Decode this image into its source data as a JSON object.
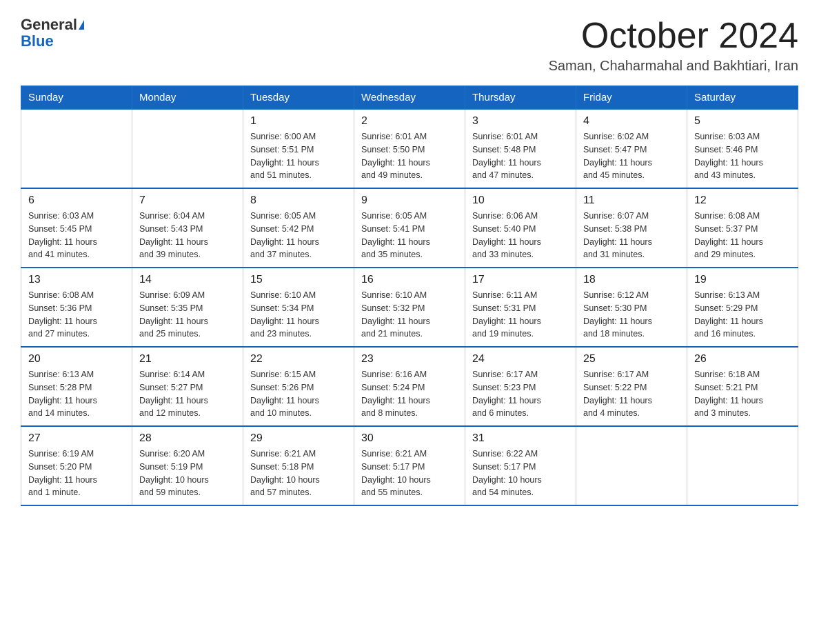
{
  "header": {
    "logo_general": "General",
    "logo_blue": "Blue",
    "title": "October 2024",
    "subtitle": "Saman, Chaharmahal and Bakhtiari, Iran"
  },
  "days_of_week": [
    "Sunday",
    "Monday",
    "Tuesday",
    "Wednesday",
    "Thursday",
    "Friday",
    "Saturday"
  ],
  "weeks": [
    [
      {
        "day": "",
        "info": ""
      },
      {
        "day": "",
        "info": ""
      },
      {
        "day": "1",
        "info": "Sunrise: 6:00 AM\nSunset: 5:51 PM\nDaylight: 11 hours\nand 51 minutes."
      },
      {
        "day": "2",
        "info": "Sunrise: 6:01 AM\nSunset: 5:50 PM\nDaylight: 11 hours\nand 49 minutes."
      },
      {
        "day": "3",
        "info": "Sunrise: 6:01 AM\nSunset: 5:48 PM\nDaylight: 11 hours\nand 47 minutes."
      },
      {
        "day": "4",
        "info": "Sunrise: 6:02 AM\nSunset: 5:47 PM\nDaylight: 11 hours\nand 45 minutes."
      },
      {
        "day": "5",
        "info": "Sunrise: 6:03 AM\nSunset: 5:46 PM\nDaylight: 11 hours\nand 43 minutes."
      }
    ],
    [
      {
        "day": "6",
        "info": "Sunrise: 6:03 AM\nSunset: 5:45 PM\nDaylight: 11 hours\nand 41 minutes."
      },
      {
        "day": "7",
        "info": "Sunrise: 6:04 AM\nSunset: 5:43 PM\nDaylight: 11 hours\nand 39 minutes."
      },
      {
        "day": "8",
        "info": "Sunrise: 6:05 AM\nSunset: 5:42 PM\nDaylight: 11 hours\nand 37 minutes."
      },
      {
        "day": "9",
        "info": "Sunrise: 6:05 AM\nSunset: 5:41 PM\nDaylight: 11 hours\nand 35 minutes."
      },
      {
        "day": "10",
        "info": "Sunrise: 6:06 AM\nSunset: 5:40 PM\nDaylight: 11 hours\nand 33 minutes."
      },
      {
        "day": "11",
        "info": "Sunrise: 6:07 AM\nSunset: 5:38 PM\nDaylight: 11 hours\nand 31 minutes."
      },
      {
        "day": "12",
        "info": "Sunrise: 6:08 AM\nSunset: 5:37 PM\nDaylight: 11 hours\nand 29 minutes."
      }
    ],
    [
      {
        "day": "13",
        "info": "Sunrise: 6:08 AM\nSunset: 5:36 PM\nDaylight: 11 hours\nand 27 minutes."
      },
      {
        "day": "14",
        "info": "Sunrise: 6:09 AM\nSunset: 5:35 PM\nDaylight: 11 hours\nand 25 minutes."
      },
      {
        "day": "15",
        "info": "Sunrise: 6:10 AM\nSunset: 5:34 PM\nDaylight: 11 hours\nand 23 minutes."
      },
      {
        "day": "16",
        "info": "Sunrise: 6:10 AM\nSunset: 5:32 PM\nDaylight: 11 hours\nand 21 minutes."
      },
      {
        "day": "17",
        "info": "Sunrise: 6:11 AM\nSunset: 5:31 PM\nDaylight: 11 hours\nand 19 minutes."
      },
      {
        "day": "18",
        "info": "Sunrise: 6:12 AM\nSunset: 5:30 PM\nDaylight: 11 hours\nand 18 minutes."
      },
      {
        "day": "19",
        "info": "Sunrise: 6:13 AM\nSunset: 5:29 PM\nDaylight: 11 hours\nand 16 minutes."
      }
    ],
    [
      {
        "day": "20",
        "info": "Sunrise: 6:13 AM\nSunset: 5:28 PM\nDaylight: 11 hours\nand 14 minutes."
      },
      {
        "day": "21",
        "info": "Sunrise: 6:14 AM\nSunset: 5:27 PM\nDaylight: 11 hours\nand 12 minutes."
      },
      {
        "day": "22",
        "info": "Sunrise: 6:15 AM\nSunset: 5:26 PM\nDaylight: 11 hours\nand 10 minutes."
      },
      {
        "day": "23",
        "info": "Sunrise: 6:16 AM\nSunset: 5:24 PM\nDaylight: 11 hours\nand 8 minutes."
      },
      {
        "day": "24",
        "info": "Sunrise: 6:17 AM\nSunset: 5:23 PM\nDaylight: 11 hours\nand 6 minutes."
      },
      {
        "day": "25",
        "info": "Sunrise: 6:17 AM\nSunset: 5:22 PM\nDaylight: 11 hours\nand 4 minutes."
      },
      {
        "day": "26",
        "info": "Sunrise: 6:18 AM\nSunset: 5:21 PM\nDaylight: 11 hours\nand 3 minutes."
      }
    ],
    [
      {
        "day": "27",
        "info": "Sunrise: 6:19 AM\nSunset: 5:20 PM\nDaylight: 11 hours\nand 1 minute."
      },
      {
        "day": "28",
        "info": "Sunrise: 6:20 AM\nSunset: 5:19 PM\nDaylight: 10 hours\nand 59 minutes."
      },
      {
        "day": "29",
        "info": "Sunrise: 6:21 AM\nSunset: 5:18 PM\nDaylight: 10 hours\nand 57 minutes."
      },
      {
        "day": "30",
        "info": "Sunrise: 6:21 AM\nSunset: 5:17 PM\nDaylight: 10 hours\nand 55 minutes."
      },
      {
        "day": "31",
        "info": "Sunrise: 6:22 AM\nSunset: 5:17 PM\nDaylight: 10 hours\nand 54 minutes."
      },
      {
        "day": "",
        "info": ""
      },
      {
        "day": "",
        "info": ""
      }
    ]
  ]
}
